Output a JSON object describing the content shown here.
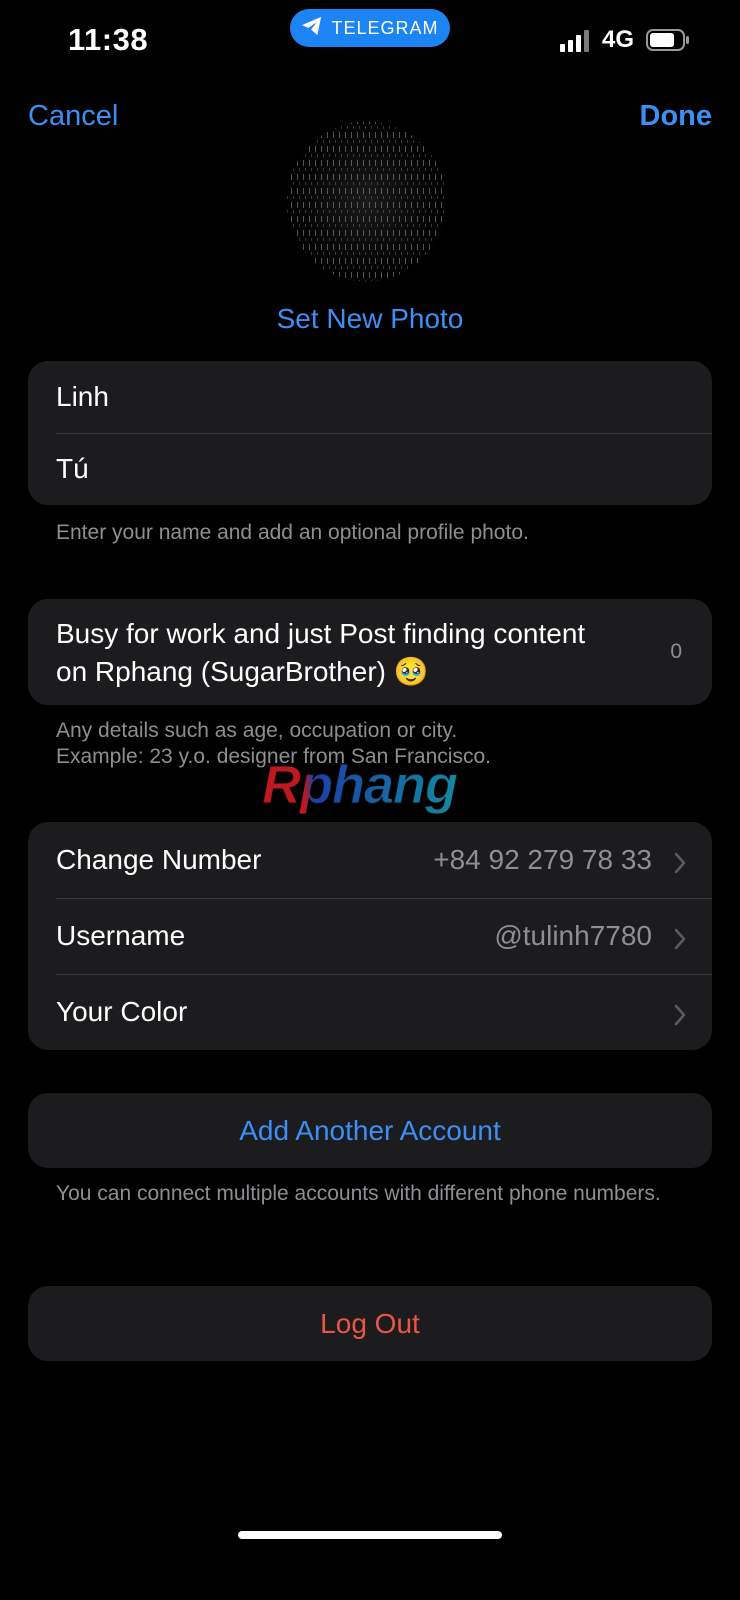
{
  "status_bar": {
    "time": "11:38",
    "app_pill": "TELEGRAM",
    "network": "4G",
    "pill_color": "#1d84f5"
  },
  "nav": {
    "cancel": "Cancel",
    "done": "Done"
  },
  "profile": {
    "set_photo": "Set New Photo",
    "first_name": "Linh",
    "last_name": "Tú",
    "name_hint": "Enter your name and add an optional profile photo."
  },
  "bio": {
    "text": "Busy for work and just Post finding content on Rphang (SugarBrother) 🥹",
    "count": "0",
    "hint_line1": "Any details such as age, occupation or city.",
    "hint_line2": "Example: 23 y.o. designer from San Francisco."
  },
  "watermark": "Rphang",
  "settings": {
    "change_number_label": "Change Number",
    "change_number_value": "+84 92 279 78 33",
    "username_label": "Username",
    "username_value": "@tulinh7780",
    "color_label": "Your Color"
  },
  "accounts": {
    "add_account": "Add Another Account",
    "hint": "You can connect multiple accounts with different phone numbers."
  },
  "logout": "Log Out",
  "colors": {
    "accent": "#3b8ff5",
    "destructive": "#eb5545",
    "background": "#000000",
    "card": "#1c1c1e",
    "secondary_text": "#8e8e93"
  }
}
